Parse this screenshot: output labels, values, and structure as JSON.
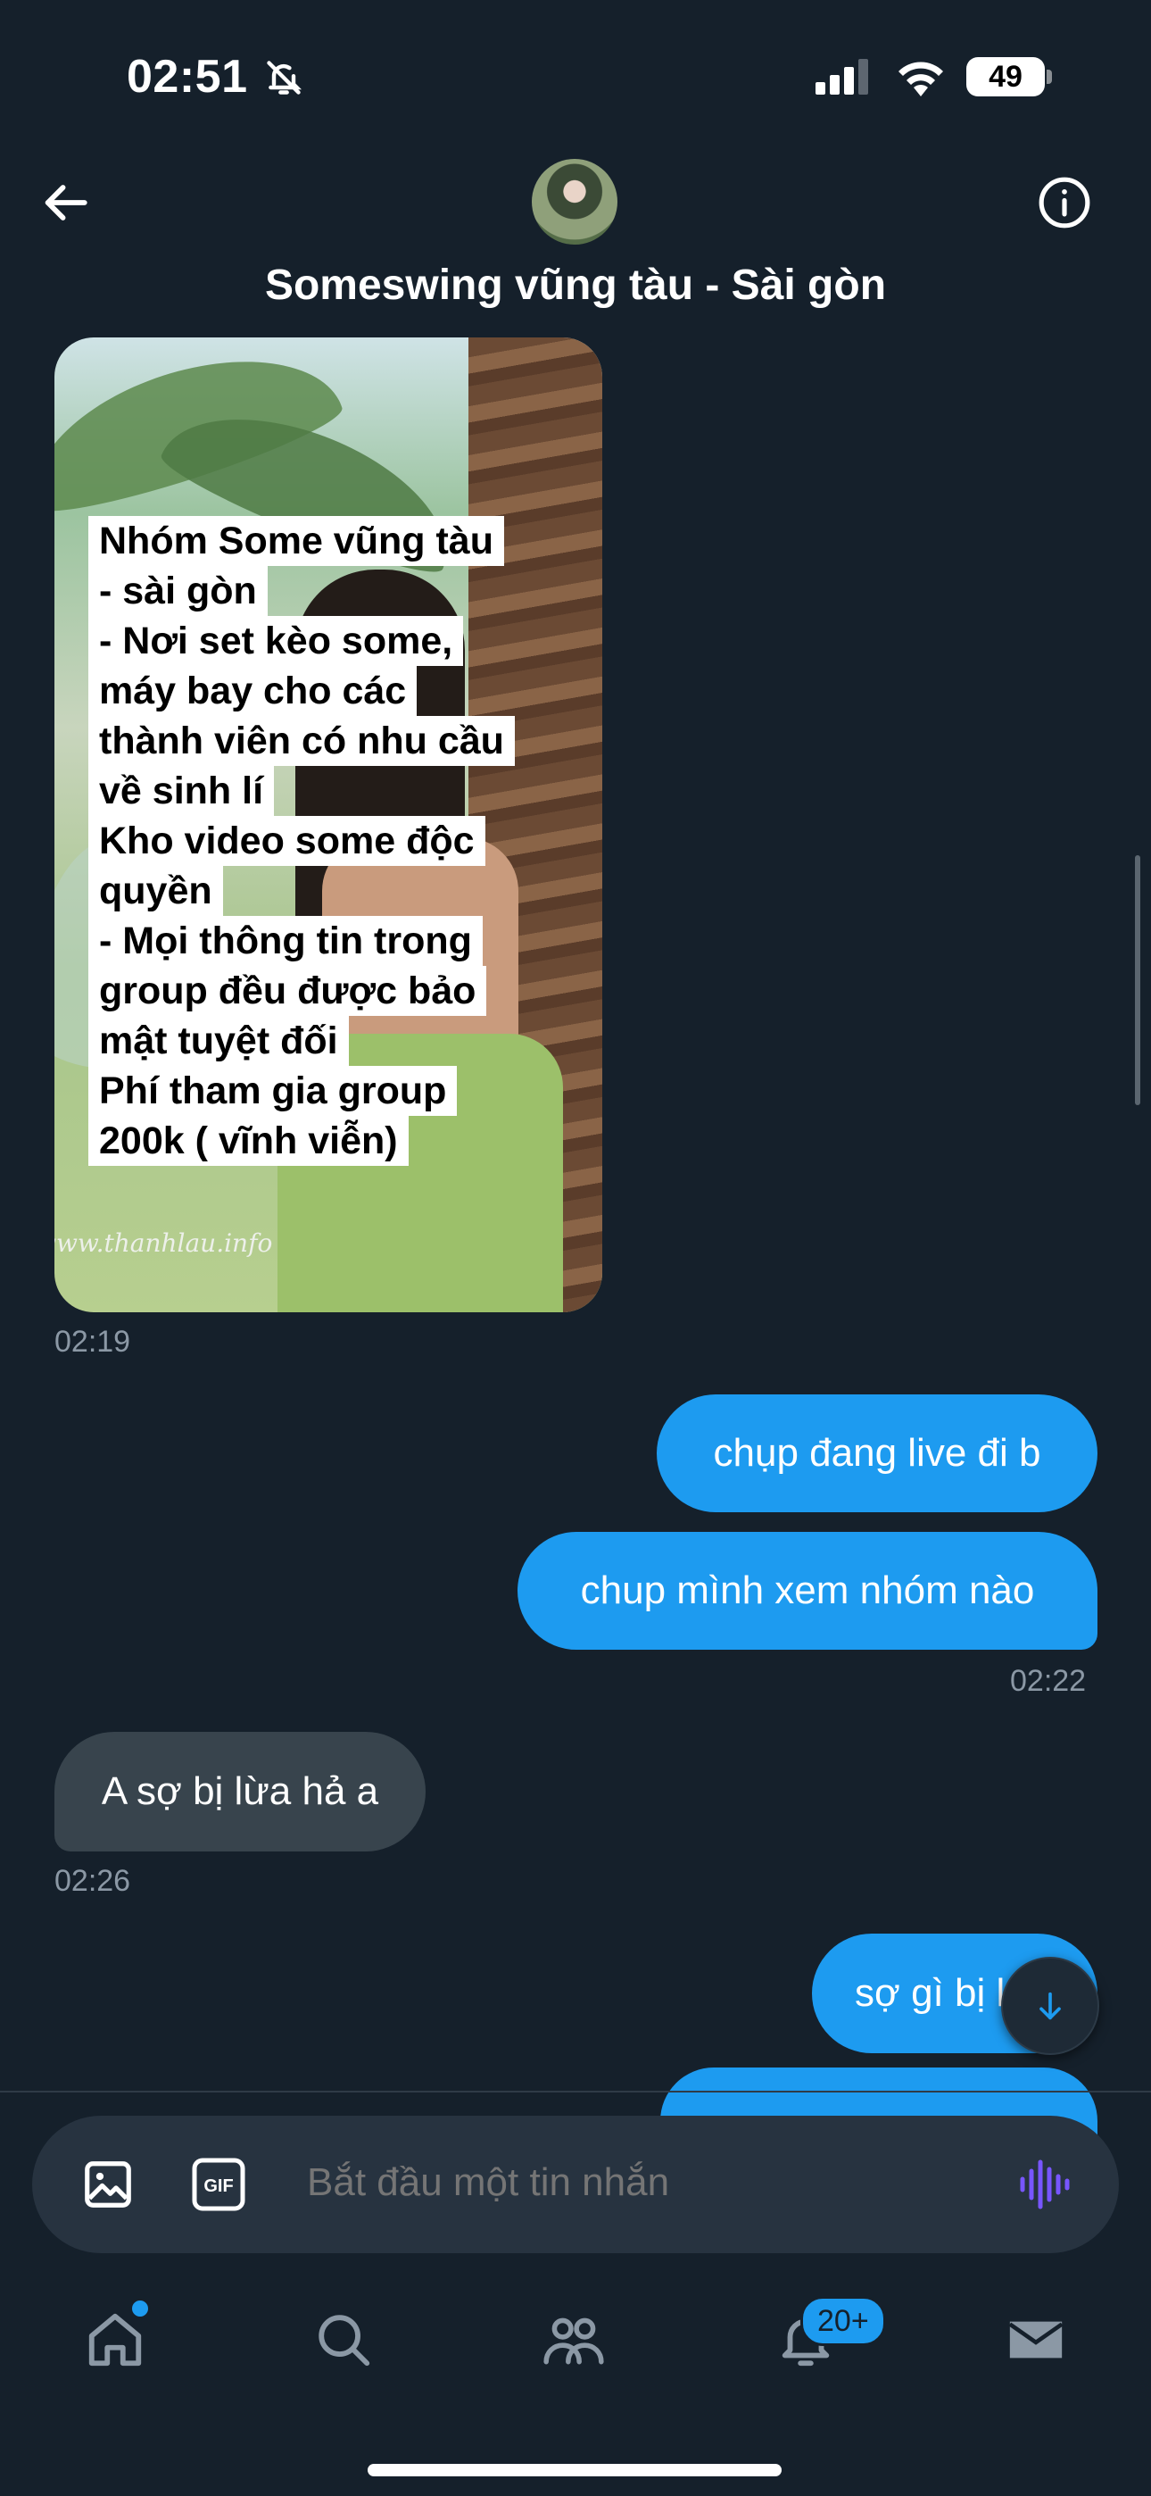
{
  "status_bar": {
    "time": "02:51",
    "battery": "49"
  },
  "header": {
    "title": "Someswing vũng tàu - Sài gòn"
  },
  "image_message": {
    "lines": [
      "Nhóm Some vũng tàu",
      "- sài gòn",
      "- Nơi set kèo some,",
      "máy bay cho các",
      "thành viên có nhu cầu",
      "về sinh lí",
      "Kho video some độc",
      "quyền",
      "- Mọi thông tin trong",
      "group đều được bảo",
      "mật tuyệt đối",
      "Phí tham gia group",
      "200k ( vĩnh viễn)"
    ],
    "watermark": "www.thanhlau.info",
    "time": "02:19"
  },
  "messages": {
    "out1": "chụp đang live đi b",
    "out2": "chup mình xem nhóm nào",
    "out_time": "02:22",
    "in1": "A sợ bị lừa hả a",
    "in_time": "02:26",
    "out3": "sợ gì bị l"
  },
  "composer": {
    "placeholder": "Bắt đầu một tin nhắn",
    "gif_label": "GIF"
  },
  "bottom_nav": {
    "notifications_badge": "20+"
  },
  "colors": {
    "accent": "#1d9bf0",
    "background": "#15202b",
    "incoming_bubble": "#38444d",
    "voice": "#7856ff"
  }
}
